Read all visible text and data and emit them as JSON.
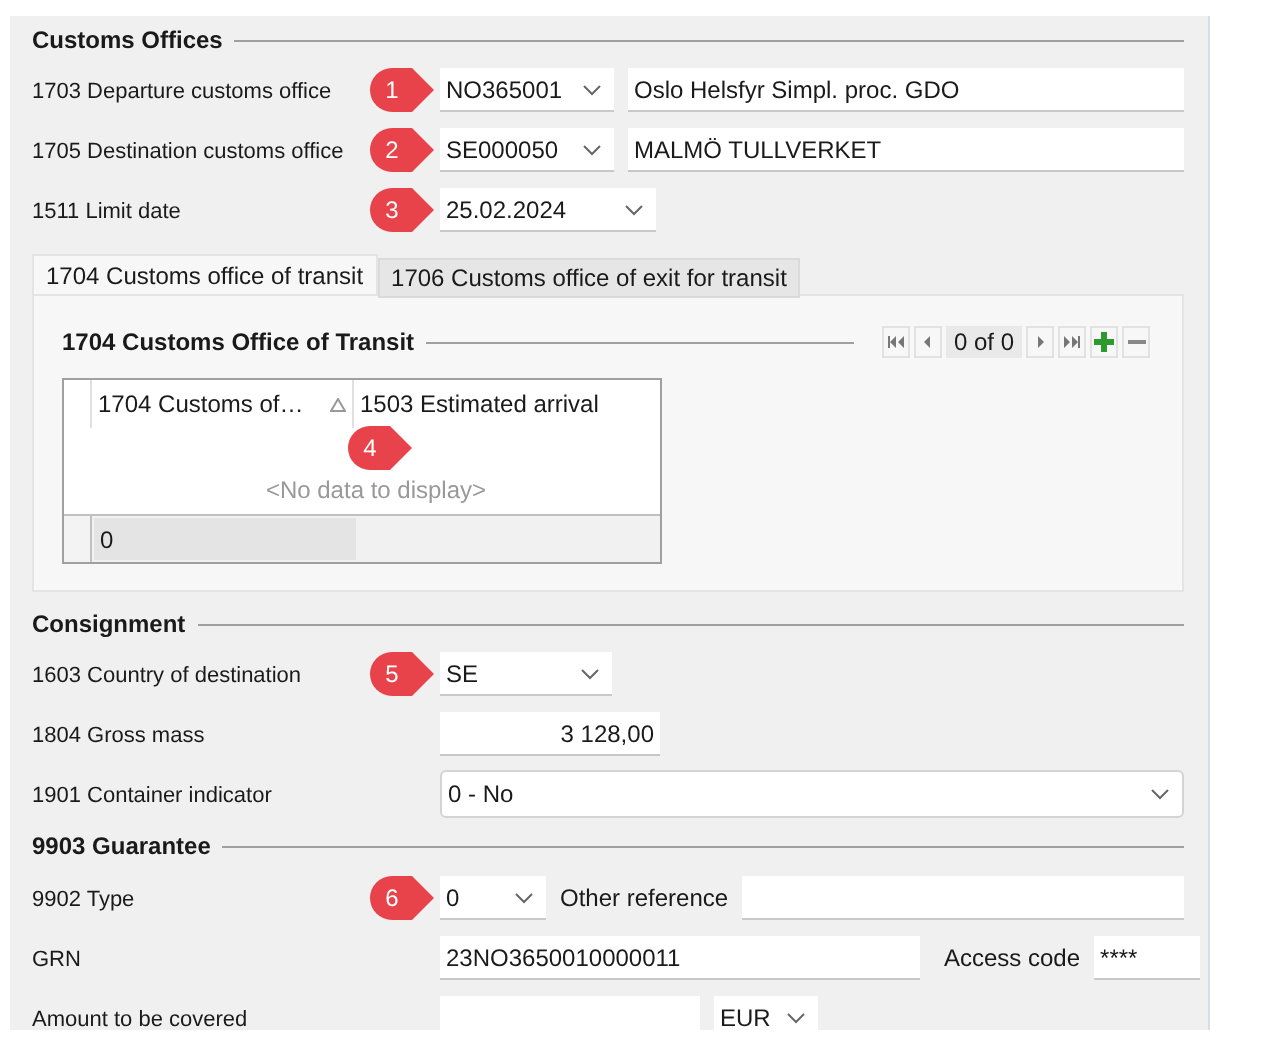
{
  "customs_offices": {
    "title": "Customs Offices",
    "fields": [
      {
        "kind": "office",
        "label": "1703 Departure customs office",
        "code": "NO365001",
        "name": "Oslo Helsfyr Simpl. proc. GDO",
        "callout": "1"
      },
      {
        "kind": "office",
        "label": "1705 Destination customs office",
        "code": "SE000050",
        "name": "MALMÖ TULLVERKET",
        "callout": "2"
      },
      {
        "kind": "date",
        "label": "1511 Limit date",
        "value": "25.02.2024",
        "callout": "3"
      }
    ]
  },
  "tabs": [
    {
      "label": "1704 Customs office of transit",
      "selected": true
    },
    {
      "label": "1706 Customs office of exit for transit",
      "selected": false
    }
  ],
  "transit": {
    "title": "1704 Customs Office of Transit",
    "pager": "0 of 0",
    "columns": [
      {
        "label": "1704 Customs of…",
        "sorted": true
      },
      {
        "label": "1503 Estimated arrival",
        "sorted": false
      }
    ],
    "empty_text": "<No data to display>",
    "footer": "0",
    "callout": "4"
  },
  "consignment": {
    "title": "Consignment",
    "fields": [
      {
        "kind": "combo",
        "label": "1603 Country of destination",
        "value": "SE",
        "callout": "5"
      },
      {
        "kind": "number",
        "label": "1804 Gross mass",
        "value": "3 128,00"
      },
      {
        "kind": "wide_combo",
        "label": "1901 Container indicator",
        "value": "0 - No"
      }
    ]
  },
  "guarantee": {
    "title": "9903 Guarantee",
    "fields": [
      {
        "kind": "type",
        "label": "9902 Type",
        "value": "0",
        "callout": "6",
        "ref_label": "Other reference"
      },
      {
        "kind": "grn",
        "label": "GRN",
        "value": "23NO3650010000011",
        "code_label": "Access code",
        "code_value": "****"
      },
      {
        "kind": "amount",
        "label": "Amount to be covered",
        "currency": "EUR"
      }
    ]
  }
}
